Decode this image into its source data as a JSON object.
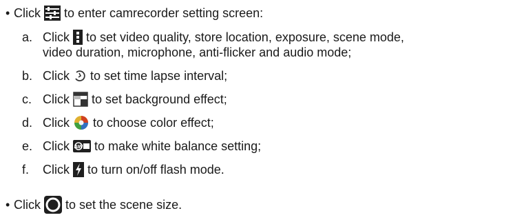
{
  "bullet_char": "•",
  "item1": {
    "prefix": "Click",
    "icon": "camcorder-settings-icon",
    "text": "to enter camrecorder setting screen:"
  },
  "subitems": [
    {
      "letter": "a.",
      "prefix": "Click",
      "icon": "vertical-dots-menu-icon",
      "text_line1": "to set video quality, store location, exposure, scene mode,",
      "text_line2": "video duration, microphone, anti-flicker and audio mode;"
    },
    {
      "letter": "b.",
      "prefix": "Click",
      "icon": "time-lapse-icon",
      "text": "to set time lapse interval;"
    },
    {
      "letter": "c.",
      "prefix": "Click",
      "icon": "background-effect-icon",
      "text": "to set background effect;"
    },
    {
      "letter": "d.",
      "prefix": "Click",
      "icon": "color-effect-icon",
      "text": "to choose color effect;"
    },
    {
      "letter": "e.",
      "prefix": "Click",
      "icon": "white-balance-icon",
      "icon_label": "AW",
      "text": "to make white balance setting;"
    },
    {
      "letter": "f.",
      "prefix": "Click",
      "icon": "flash-icon",
      "text": "to turn on/off flash mode."
    }
  ],
  "item2": {
    "prefix": "Click",
    "icon": "scene-size-circle-icon",
    "text": "to set the scene size."
  }
}
